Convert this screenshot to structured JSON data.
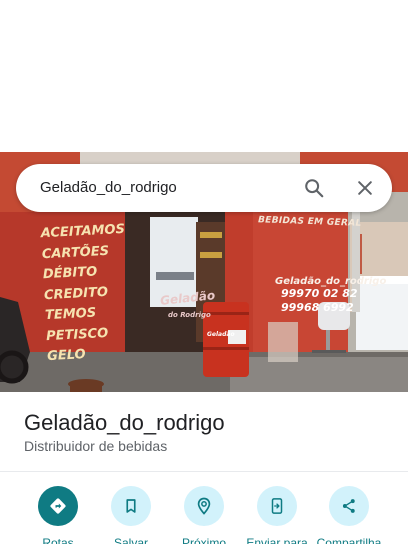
{
  "search": {
    "query": "Geladão_do_rodrigo"
  },
  "photo": {
    "menu_lines": [
      "ACEITAMOS",
      "CARTÕES",
      "DÉBITO",
      "CREDITO",
      "TEMOS",
      "PETISCO",
      "GELO"
    ],
    "wall_heading": "BEBIDAS EM GERAL",
    "wall_brand": "Geladão_do_rodrigo",
    "phone_1": "99970 02 82",
    "phone_2": "99968 6992",
    "door_sign": "Geladão",
    "door_sign_sub": "do Rodrigo",
    "drum_label": "Geladão"
  },
  "place": {
    "title": "Geladão_do_rodrigo",
    "category": "Distribuidor de bebidas"
  },
  "actions": [
    {
      "label": "Rotas",
      "icon": "directions-icon"
    },
    {
      "label": "Salvar",
      "icon": "bookmark-icon"
    },
    {
      "label": "Próximo",
      "icon": "nearby-icon"
    },
    {
      "label": "Enviar para",
      "icon": "send-to-phone-icon"
    },
    {
      "label": "Compartilha",
      "icon": "share-icon"
    }
  ],
  "colors": {
    "accent": "#0f7b83",
    "action_bg": "#d2f2fb",
    "wall": "#b33b2a"
  }
}
